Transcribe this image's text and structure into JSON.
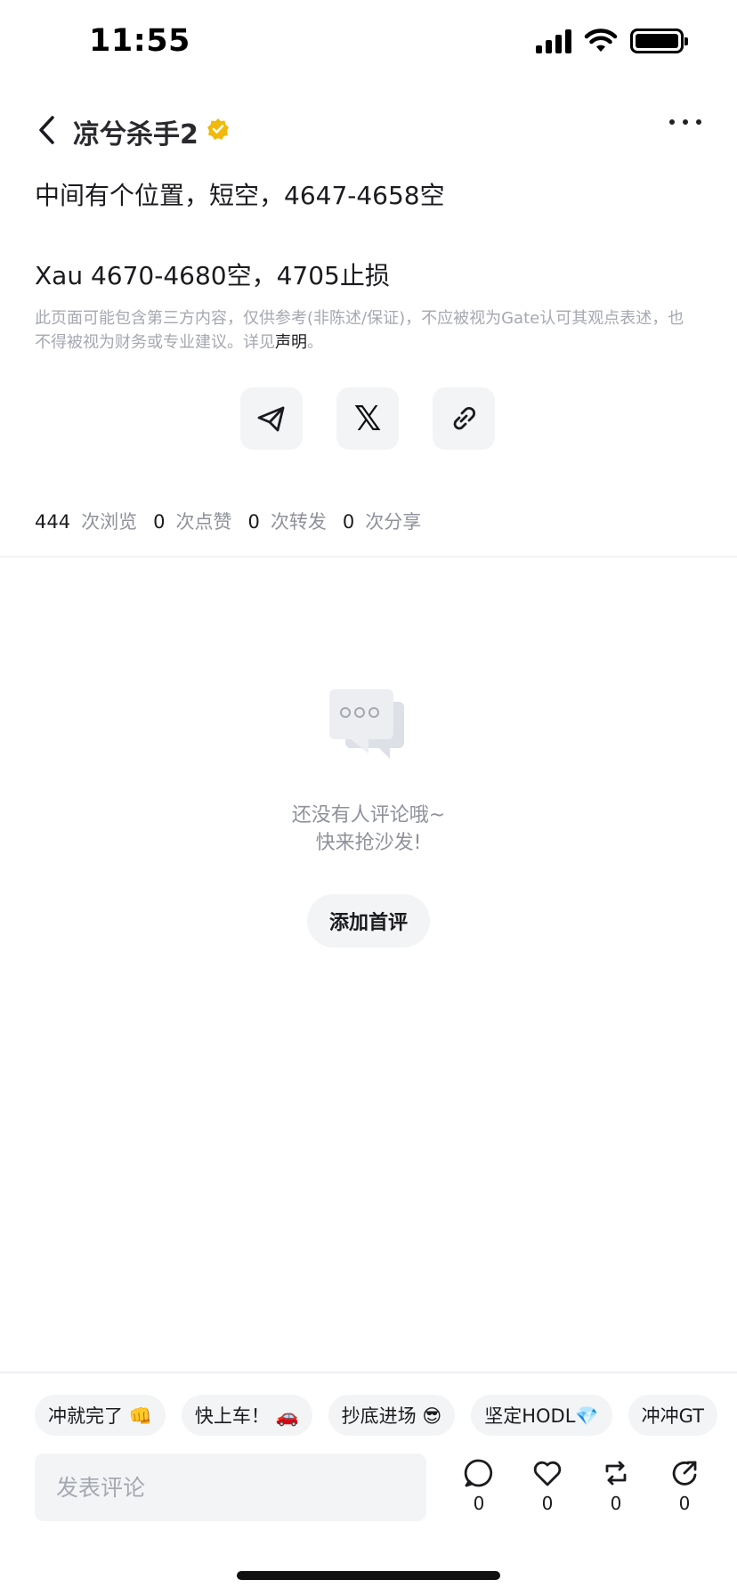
{
  "status_bar": {
    "time": "11:55"
  },
  "header": {
    "user_name": "凉兮杀手2"
  },
  "post": {
    "line1": "中间有个位置，短空，4647-4658空",
    "line2": "Xau 4670-4680空，4705止损"
  },
  "disclaimer": {
    "text": "此页面可能包含第三方内容，仅供参考(非陈述/保证)，不应被视为Gate认可其观点表述，也不得被视为财务或专业建议。详见",
    "link": "声明",
    "end": "。"
  },
  "share": {
    "x_label": "𝕏"
  },
  "stats": {
    "views": "444",
    "views_label": "次浏览",
    "likes": "0",
    "likes_label": "次点赞",
    "reposts": "0",
    "reposts_label": "次转发",
    "shares": "0",
    "shares_label": "次分享"
  },
  "empty_comments": {
    "line1": "还没有人评论哦~",
    "line2": "快来抢沙发!",
    "button": "添加首评"
  },
  "quick_replies": [
    {
      "label": "冲就完了 👊"
    },
    {
      "label": "快上车！ 🚗"
    },
    {
      "label": "抄底进场 😎"
    },
    {
      "label": "坚定HODL💎"
    },
    {
      "label": "冲冲GT"
    }
  ],
  "comment_box": {
    "placeholder": "发表评论"
  },
  "actions": {
    "comment_count": "0",
    "like_count": "0",
    "repost_count": "0",
    "share_count": "0"
  },
  "colors": {
    "text": "#1b1b1f",
    "muted": "#8f929a",
    "chip_bg": "#f3f4f6",
    "verified": "#f0b90b"
  },
  "icons": [
    "chevron-left-icon",
    "verified-badge-icon",
    "more-icon",
    "telegram-icon",
    "x-icon",
    "link-icon",
    "chat-bubble-icon",
    "comment-icon",
    "heart-icon",
    "repost-icon",
    "share-icon"
  ]
}
